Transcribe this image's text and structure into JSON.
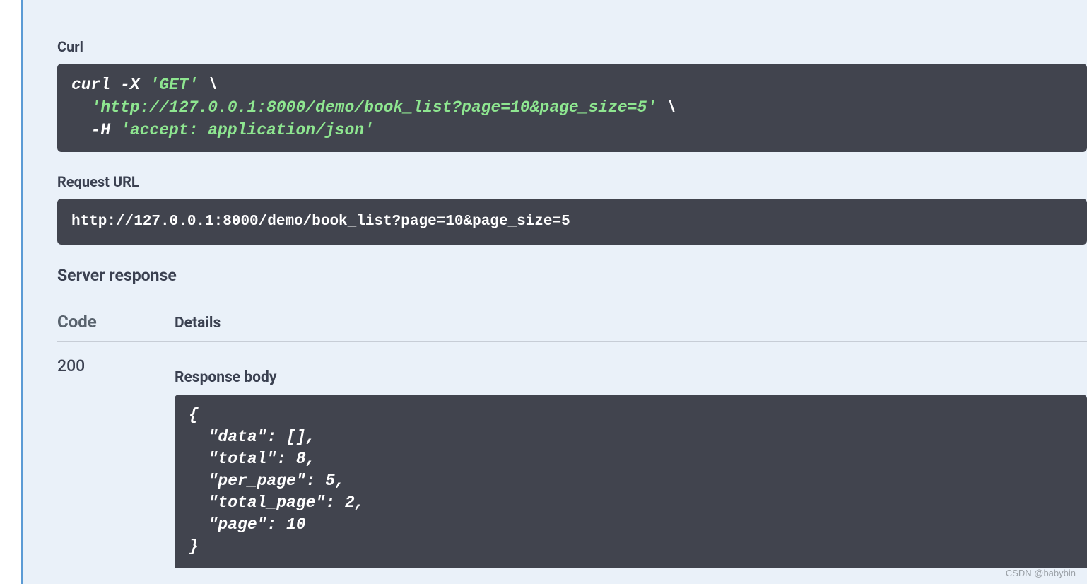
{
  "sections": {
    "curl_label": "Curl",
    "request_url_label": "Request URL",
    "server_response_label": "Server response",
    "code_header": "Code",
    "details_header": "Details",
    "response_body_label": "Response body"
  },
  "curl": {
    "line1_prefix": "curl -X ",
    "line1_method": "'GET'",
    "line1_suffix": " \\",
    "line2_indent": "  ",
    "line2_url": "'http://127.0.0.1:8000/demo/book_list?page=10&page_size=5'",
    "line2_suffix": " \\",
    "line3_prefix": "  -H ",
    "line3_header": "'accept: application/json'"
  },
  "request_url": "http://127.0.0.1:8000/demo/book_list?page=10&page_size=5",
  "response": {
    "status_code": "200",
    "body": {
      "open_brace": "{",
      "data_key": "  \"data\"",
      "data_colon": ": ",
      "data_val": "[]",
      "data_comma": ",",
      "total_key": "  \"total\"",
      "total_colon": ": ",
      "total_val": "8",
      "total_comma": ",",
      "per_page_key": "  \"per_page\"",
      "per_page_colon": ": ",
      "per_page_val": "5",
      "per_page_comma": ",",
      "total_page_key": "  \"total_page\"",
      "total_page_colon": ": ",
      "total_page_val": "2",
      "total_page_comma": ",",
      "page_key": "  \"page\"",
      "page_colon": ": ",
      "page_val": "10",
      "close_brace": "}"
    }
  },
  "watermark": "CSDN @babybin"
}
